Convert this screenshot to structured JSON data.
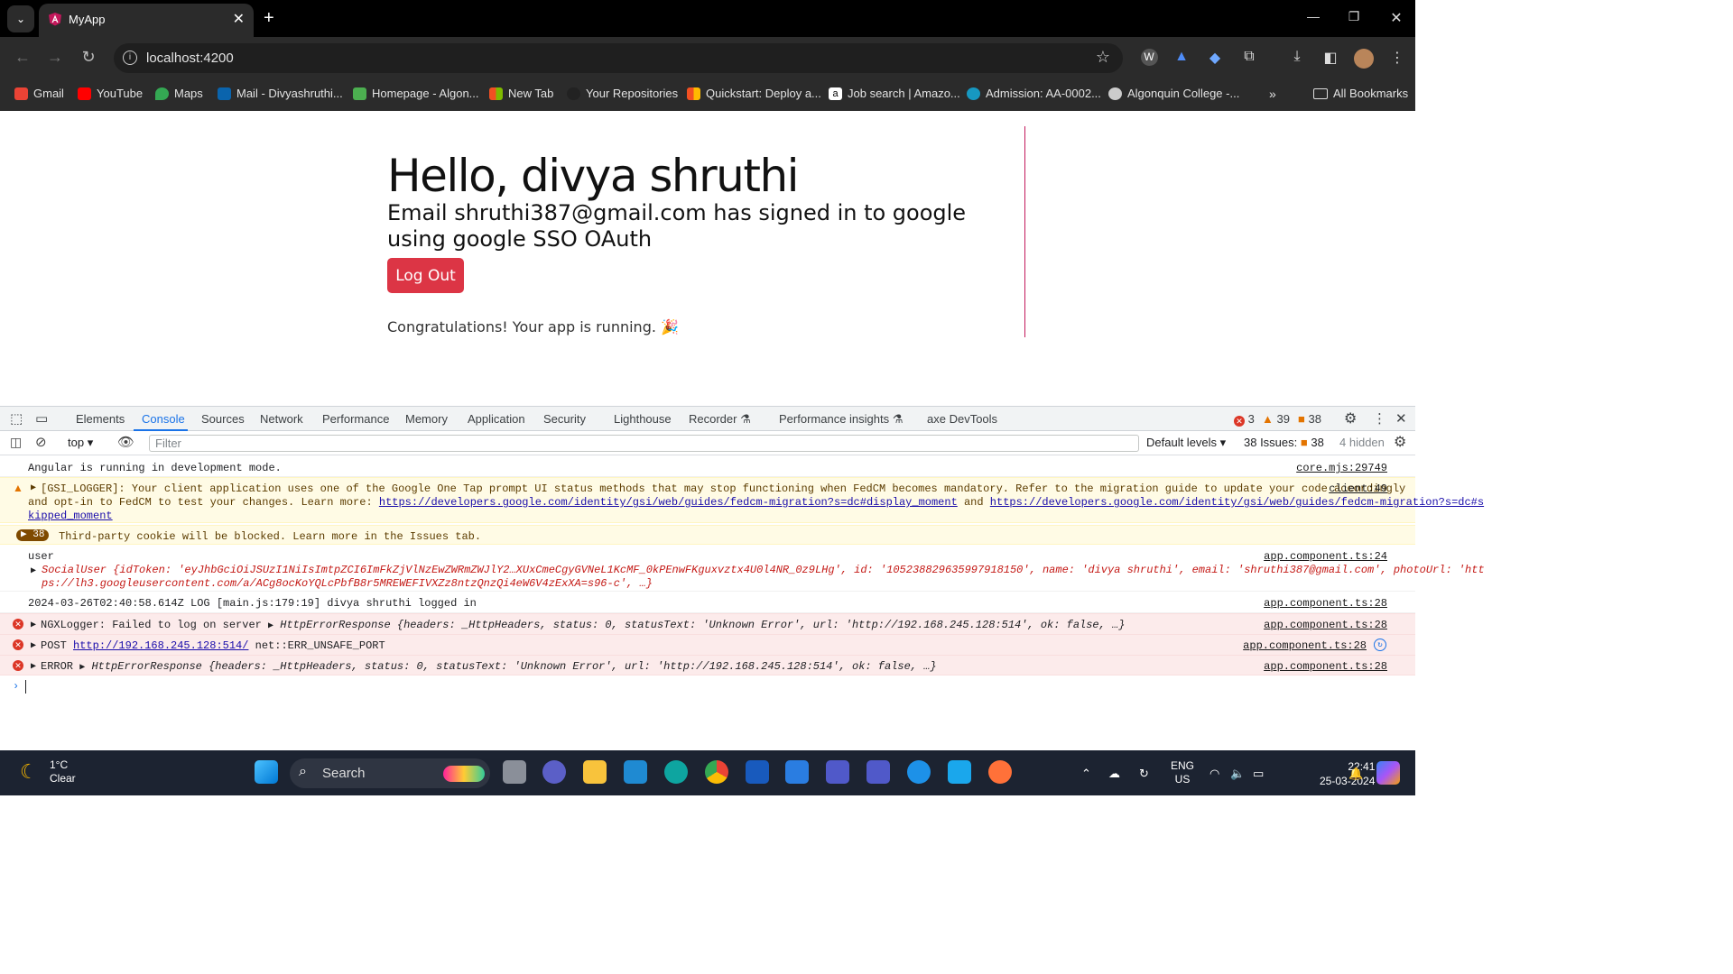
{
  "browser": {
    "tab_title": "MyApp",
    "url": "localhost:4200",
    "bookmarks": [
      "Gmail",
      "YouTube",
      "Maps",
      "Mail - Divyashruthi...",
      "Homepage - Algon...",
      "New Tab",
      "Your Repositories",
      "Quickstart: Deploy a...",
      "Job search | Amazo...",
      "Admission: AA-0002...",
      "Algonquin College -..."
    ],
    "all_bookmarks": "All Bookmarks"
  },
  "page": {
    "greeting": "Hello, divya shruthi",
    "email_line": "Email shruthi387@gmail.com has signed in to google using google SSO OAuth",
    "logout_label": "Log Out",
    "congrats": "Congratulations! Your app is running. 🎉"
  },
  "devtools": {
    "tabs": [
      "Elements",
      "Console",
      "Sources",
      "Network",
      "Performance",
      "Memory",
      "Application",
      "Security",
      "Lighthouse",
      "Recorder",
      "Performance insights",
      "axe DevTools"
    ],
    "active_tab": "Console",
    "error_count": "3",
    "warning_count": "39",
    "issue_count": "38",
    "context": "top",
    "filter_placeholder": "Filter",
    "levels": "Default levels",
    "issues_label": "38 Issues:",
    "issues_badge": "38",
    "hidden": "4 hidden",
    "console": {
      "angular_msg": "Angular is running in development mode.",
      "angular_src": "core.mjs:29749",
      "gsi_text1": "[GSI_LOGGER]: Your client application uses one of the Google One Tap prompt UI status methods that may stop functioning when FedCM becomes mandatory. Refer to the migration guide to update your code accordingly",
      "gsi_text2": "and opt-in to FedCM to test your changes. Learn more: ",
      "gsi_link1": "https://developers.google.com/identity/gsi/web/guides/fedcm-migration?s=dc#display_moment",
      "gsi_and": " and ",
      "gsi_link2": "https://developers.google.com/identity/gsi/web/guides/fedcm-migration?s=dc#s",
      "gsi_link2b": "kipped_moment",
      "gsi_src": "client:49",
      "cookie_count": "38",
      "cookie_msg": "Third-party cookie will be blocked. Learn more in the Issues tab.",
      "user_label": "user",
      "user_src": "app.component.ts:24",
      "social_line1": "SocialUser {idToken: 'eyJhbGciOiJSUzI1NiIsImtpZCI6ImFkZjVlNzEwZWRmZWJlY2…XUxCmeCgyGVNeL1KcMF_0kPEnwFKguxvztx4U0l4NR_0z9LHg', id: '105238829635997918150', name: 'divya shruthi', email: 'shruthi387@gmail.com', photoUrl: 'htt",
      "social_line2": "ps://lh3.googleusercontent.com/a/ACg8ocKoYQLcPbfB8r5MREWEFIVXZz8ntzQnzQi4eW6V4zExXA=s96-c', …}",
      "log_msg": "2024-03-26T02:40:58.614Z LOG [main.js:179:19] divya shruthi logged in",
      "log_src": "app.component.ts:28",
      "ngx_label": "NGXLogger: Failed to log on server",
      "ngx_obj": "HttpErrorResponse {headers: _HttpHeaders, status: 0, statusText: 'Unknown Error', url: 'http://192.168.245.128:514', ok: false, …}",
      "ngx_src": "app.component.ts:28",
      "post_label": "POST ",
      "post_link": "http://192.168.245.128:514/",
      "post_err": " net::ERR_UNSAFE_PORT",
      "post_src": "app.component.ts:28",
      "err_label": "ERROR",
      "err_obj": "HttpErrorResponse {headers: _HttpHeaders, status: 0, statusText: 'Unknown Error', url: 'http://192.168.245.128:514', ok: false, …}",
      "err_src": "app.component.ts:28"
    }
  },
  "taskbar": {
    "temp": "1°C",
    "condition": "Clear",
    "search": "Search",
    "lang1": "ENG",
    "lang2": "US",
    "time": "22:41",
    "date": "25-03-2024"
  }
}
